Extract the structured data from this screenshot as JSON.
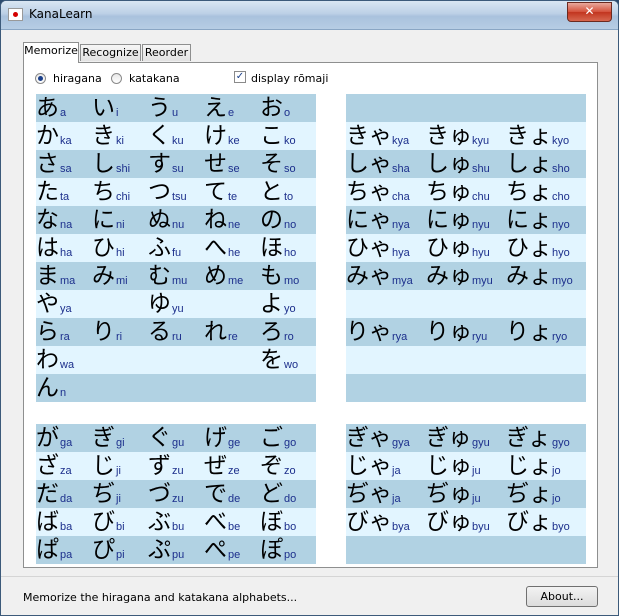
{
  "window": {
    "title": "KanaLearn",
    "close_label": "✕"
  },
  "tabs": [
    {
      "label": "Memorize",
      "active": true
    },
    {
      "label": "Recognize",
      "active": false
    },
    {
      "label": "Reorder",
      "active": false
    }
  ],
  "options": {
    "hiragana_label": "hiragana",
    "katakana_label": "katakana",
    "romaji_label": "display rōmaji",
    "selected": "hiragana",
    "romaji_checked": true
  },
  "colors": {
    "row_dark": "#b1d2e3",
    "row_light": "#e2f5ff",
    "romaji": "#1c2f8c"
  },
  "grids": {
    "basic": [
      [
        [
          "あ",
          "a"
        ],
        [
          "い",
          "i"
        ],
        [
          "う",
          "u"
        ],
        [
          "え",
          "e"
        ],
        [
          "お",
          "o"
        ]
      ],
      [
        [
          "か",
          "ka"
        ],
        [
          "き",
          "ki"
        ],
        [
          "く",
          "ku"
        ],
        [
          "け",
          "ke"
        ],
        [
          "こ",
          "ko"
        ]
      ],
      [
        [
          "さ",
          "sa"
        ],
        [
          "し",
          "shi"
        ],
        [
          "す",
          "su"
        ],
        [
          "せ",
          "se"
        ],
        [
          "そ",
          "so"
        ]
      ],
      [
        [
          "た",
          "ta"
        ],
        [
          "ち",
          "chi"
        ],
        [
          "つ",
          "tsu"
        ],
        [
          "て",
          "te"
        ],
        [
          "と",
          "to"
        ]
      ],
      [
        [
          "な",
          "na"
        ],
        [
          "に",
          "ni"
        ],
        [
          "ぬ",
          "nu"
        ],
        [
          "ね",
          "ne"
        ],
        [
          "の",
          "no"
        ]
      ],
      [
        [
          "は",
          "ha"
        ],
        [
          "ひ",
          "hi"
        ],
        [
          "ふ",
          "fu"
        ],
        [
          "へ",
          "he"
        ],
        [
          "ほ",
          "ho"
        ]
      ],
      [
        [
          "ま",
          "ma"
        ],
        [
          "み",
          "mi"
        ],
        [
          "む",
          "mu"
        ],
        [
          "め",
          "me"
        ],
        [
          "も",
          "mo"
        ]
      ],
      [
        [
          "や",
          "ya"
        ],
        null,
        [
          "ゆ",
          "yu"
        ],
        null,
        [
          "よ",
          "yo"
        ]
      ],
      [
        [
          "ら",
          "ra"
        ],
        [
          "り",
          "ri"
        ],
        [
          "る",
          "ru"
        ],
        [
          "れ",
          "re"
        ],
        [
          "ろ",
          "ro"
        ]
      ],
      [
        [
          "わ",
          "wa"
        ],
        null,
        null,
        null,
        [
          "を",
          "wo"
        ]
      ],
      [
        [
          "ん",
          "n"
        ],
        null,
        null,
        null,
        null
      ]
    ],
    "combo": [
      [
        null,
        null,
        null
      ],
      [
        [
          "きゃ",
          "kya"
        ],
        [
          "きゅ",
          "kyu"
        ],
        [
          "きょ",
          "kyo"
        ]
      ],
      [
        [
          "しゃ",
          "sha"
        ],
        [
          "しゅ",
          "shu"
        ],
        [
          "しょ",
          "sho"
        ]
      ],
      [
        [
          "ちゃ",
          "cha"
        ],
        [
          "ちゅ",
          "chu"
        ],
        [
          "ちょ",
          "cho"
        ]
      ],
      [
        [
          "にゃ",
          "nya"
        ],
        [
          "にゅ",
          "nyu"
        ],
        [
          "にょ",
          "nyo"
        ]
      ],
      [
        [
          "ひゃ",
          "hya"
        ],
        [
          "ひゅ",
          "hyu"
        ],
        [
          "ひょ",
          "hyo"
        ]
      ],
      [
        [
          "みゃ",
          "mya"
        ],
        [
          "みゅ",
          "myu"
        ],
        [
          "みょ",
          "myo"
        ]
      ],
      [
        null,
        null,
        null
      ],
      [
        [
          "りゃ",
          "rya"
        ],
        [
          "りゅ",
          "ryu"
        ],
        [
          "りょ",
          "ryo"
        ]
      ],
      [
        null,
        null,
        null
      ],
      [
        null,
        null,
        null
      ]
    ],
    "voiced": [
      [
        [
          "が",
          "ga"
        ],
        [
          "ぎ",
          "gi"
        ],
        [
          "ぐ",
          "gu"
        ],
        [
          "げ",
          "ge"
        ],
        [
          "ご",
          "go"
        ]
      ],
      [
        [
          "ざ",
          "za"
        ],
        [
          "じ",
          "ji"
        ],
        [
          "ず",
          "zu"
        ],
        [
          "ぜ",
          "ze"
        ],
        [
          "ぞ",
          "zo"
        ]
      ],
      [
        [
          "だ",
          "da"
        ],
        [
          "ぢ",
          "ji"
        ],
        [
          "づ",
          "zu"
        ],
        [
          "で",
          "de"
        ],
        [
          "ど",
          "do"
        ]
      ],
      [
        [
          "ば",
          "ba"
        ],
        [
          "び",
          "bi"
        ],
        [
          "ぶ",
          "bu"
        ],
        [
          "べ",
          "be"
        ],
        [
          "ぼ",
          "bo"
        ]
      ],
      [
        [
          "ぱ",
          "pa"
        ],
        [
          "ぴ",
          "pi"
        ],
        [
          "ぷ",
          "pu"
        ],
        [
          "ぺ",
          "pe"
        ],
        [
          "ぽ",
          "po"
        ]
      ]
    ],
    "voiced_combo": [
      [
        [
          "ぎゃ",
          "gya"
        ],
        [
          "ぎゅ",
          "gyu"
        ],
        [
          "ぎょ",
          "gyo"
        ]
      ],
      [
        [
          "じゃ",
          "ja"
        ],
        [
          "じゅ",
          "ju"
        ],
        [
          "じょ",
          "jo"
        ]
      ],
      [
        [
          "ぢゃ",
          "ja"
        ],
        [
          "ぢゅ",
          "ju"
        ],
        [
          "ぢょ",
          "jo"
        ]
      ],
      [
        [
          "びゃ",
          "bya"
        ],
        [
          "びゅ",
          "byu"
        ],
        [
          "びょ",
          "byo"
        ]
      ],
      [
        null,
        null,
        null
      ]
    ]
  },
  "status": {
    "text": "Memorize the hiragana and katakana alphabets...",
    "about_label": "About..."
  }
}
